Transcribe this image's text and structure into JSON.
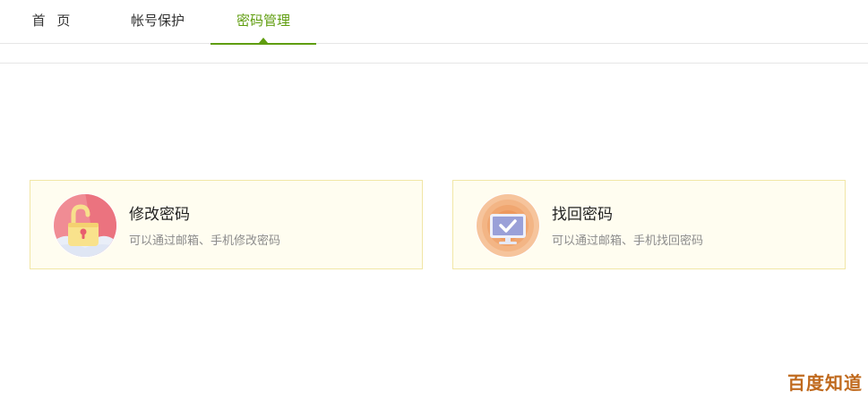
{
  "nav": {
    "tabs": [
      {
        "label": "首 页",
        "active": false
      },
      {
        "label": "帐号保护",
        "active": false
      },
      {
        "label": "密码管理",
        "active": true
      }
    ],
    "accent_color": "#5f9d0f"
  },
  "cards": [
    {
      "title": "修改密码",
      "description": "可以通过邮箱、手机修改密码",
      "icon": "unlocked-padlock-icon"
    },
    {
      "title": "找回密码",
      "description": "可以通过邮箱、手机找回密码",
      "icon": "monitor-check-icon"
    }
  ],
  "watermark": "百度知道"
}
